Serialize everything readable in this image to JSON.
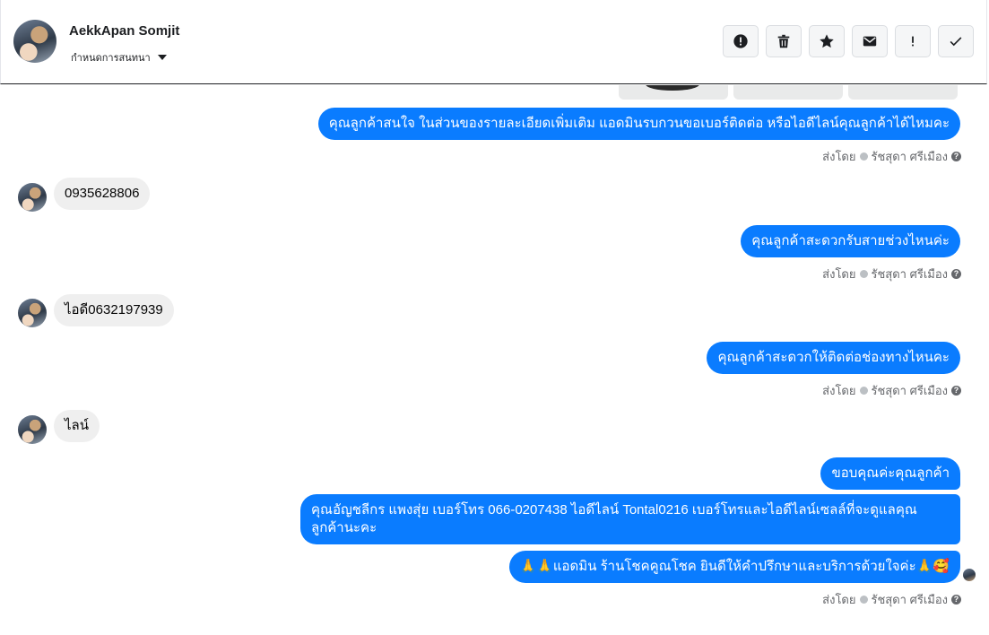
{
  "header": {
    "contact_name": "AekkApan Somjit",
    "assign_label": "กำหนดการสนทนา",
    "toolbar": [
      {
        "name": "mark-spam-button",
        "icon": "alert-circle-icon"
      },
      {
        "name": "delete-button",
        "icon": "trash-icon"
      },
      {
        "name": "star-button",
        "icon": "star-icon"
      },
      {
        "name": "mark-unread-button",
        "icon": "envelope-icon"
      },
      {
        "name": "follow-up-button",
        "icon": "exclamation-icon"
      },
      {
        "name": "mark-done-button",
        "icon": "checkmark-icon"
      }
    ]
  },
  "conversation": {
    "messages": [
      {
        "dir": "out",
        "text": "คุณลูกค้าสนใจ ในส่วนของรายละเอียดเพิ่มเติม แอดมินรบกวนขอเบอร์ติดต่อ หรือไอดีไลน์คุณลูกค้าได้ไหมคะ",
        "sent_by_label": "ส่งโดย",
        "sender": "รัชสุดา ศรีเมือง"
      },
      {
        "dir": "in",
        "text": "0935628806"
      },
      {
        "dir": "out",
        "text": "คุณลูกค้าสะดวกรับสายช่วงไหนค่ะ",
        "sent_by_label": "ส่งโดย",
        "sender": "รัชสุดา ศรีเมือง"
      },
      {
        "dir": "in",
        "text": "ไอดี0632197939"
      },
      {
        "dir": "out",
        "text": "คุณลูกค้าสะดวกให้ติดต่อช่องทางไหนคะ",
        "sent_by_label": "ส่งโดย",
        "sender": "รัชสุดา ศรีเมือง"
      },
      {
        "dir": "in",
        "text": "ไลน์"
      },
      {
        "dir": "out",
        "text": "ขอบคุณค่ะคุณลูกค้า"
      },
      {
        "dir": "out",
        "text": "คุณอัญชลีกร แพงสุ่ย      เบอร์โทร 066-0207438 ไอดีไลน์ Tontal0216   เบอร์โทรและไอดีไลน์เซลล์ที่จะดูแลคุณลูกค้านะคะ"
      },
      {
        "dir": "out",
        "text": "🙏🙏แอดมิน ร้านโชคคูณโชค ยินดีให้คำปรึกษาและบริการด้วยใจค่ะ🙏🥰",
        "sent_by_label": "ส่งโดย",
        "sender": "รัชสุดา ศรีเมือง"
      }
    ]
  },
  "colors": {
    "outgoing_bubble": "#0a7cff",
    "incoming_bubble": "#efefef"
  }
}
